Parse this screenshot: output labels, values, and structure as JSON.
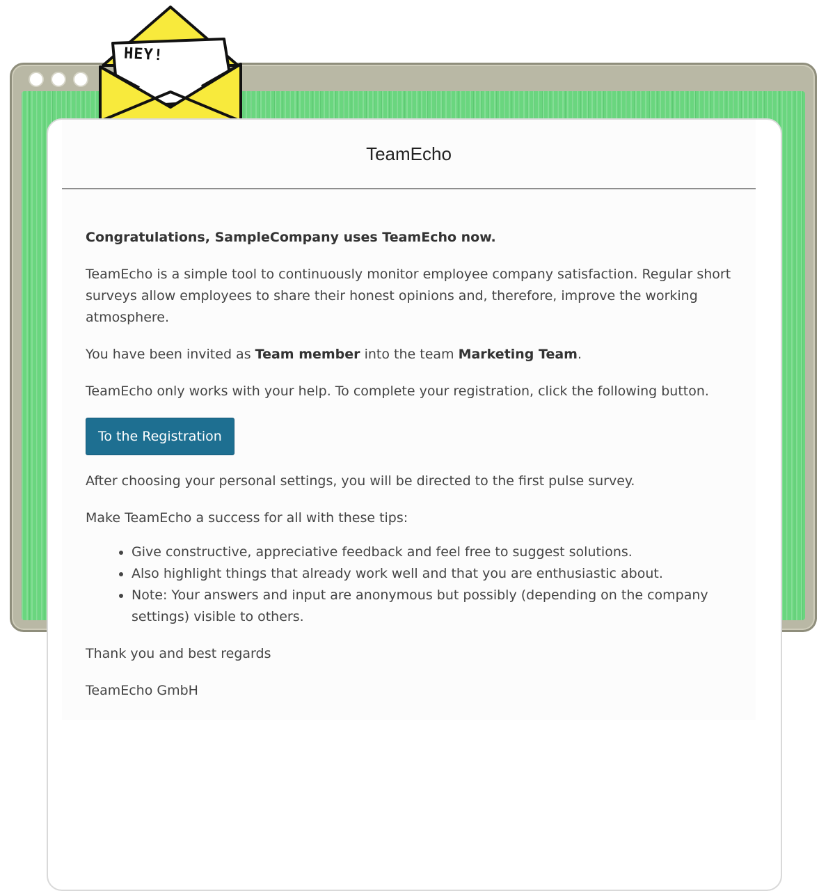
{
  "email": {
    "title": "TeamEcho",
    "headline": "Congratulations, SampleCompany uses TeamEcho now.",
    "intro": "TeamEcho is a simple tool to continuously monitor employee company satisfaction. Regular short surveys allow employees to share their honest opinions and, therefore, improve the working atmosphere.",
    "invite": {
      "prefix": "You have been invited as ",
      "role": "Team member",
      "middle": " into the team ",
      "team": "Marketing Team",
      "suffix": "."
    },
    "help_text": "TeamEcho only works with your help. To complete your registration, click the following button.",
    "button_label": "To the Registration",
    "after_text": "After choosing your personal settings, you will be directed to the first pulse survey.",
    "tips_intro": "Make TeamEcho a success for all with these tips:",
    "tips": [
      "Give constructive, appreciative feedback and feel free to suggest solutions.",
      "Also highlight things that already work well and that you are enthusiastic about.",
      "Note: Your answers and input are anonymous but possibly (depending on the company settings) visible to others."
    ],
    "signoff_line1": "Thank you and best regards",
    "signoff_line2": "TeamEcho GmbH"
  },
  "illustration": {
    "envelope_text": "HEY!",
    "icon": "envelope-icon",
    "colors": {
      "envelope": "#f8ea3c",
      "screen": "#6ad67f",
      "frame": "#b9b8a5",
      "button": "#1e6f91"
    }
  }
}
